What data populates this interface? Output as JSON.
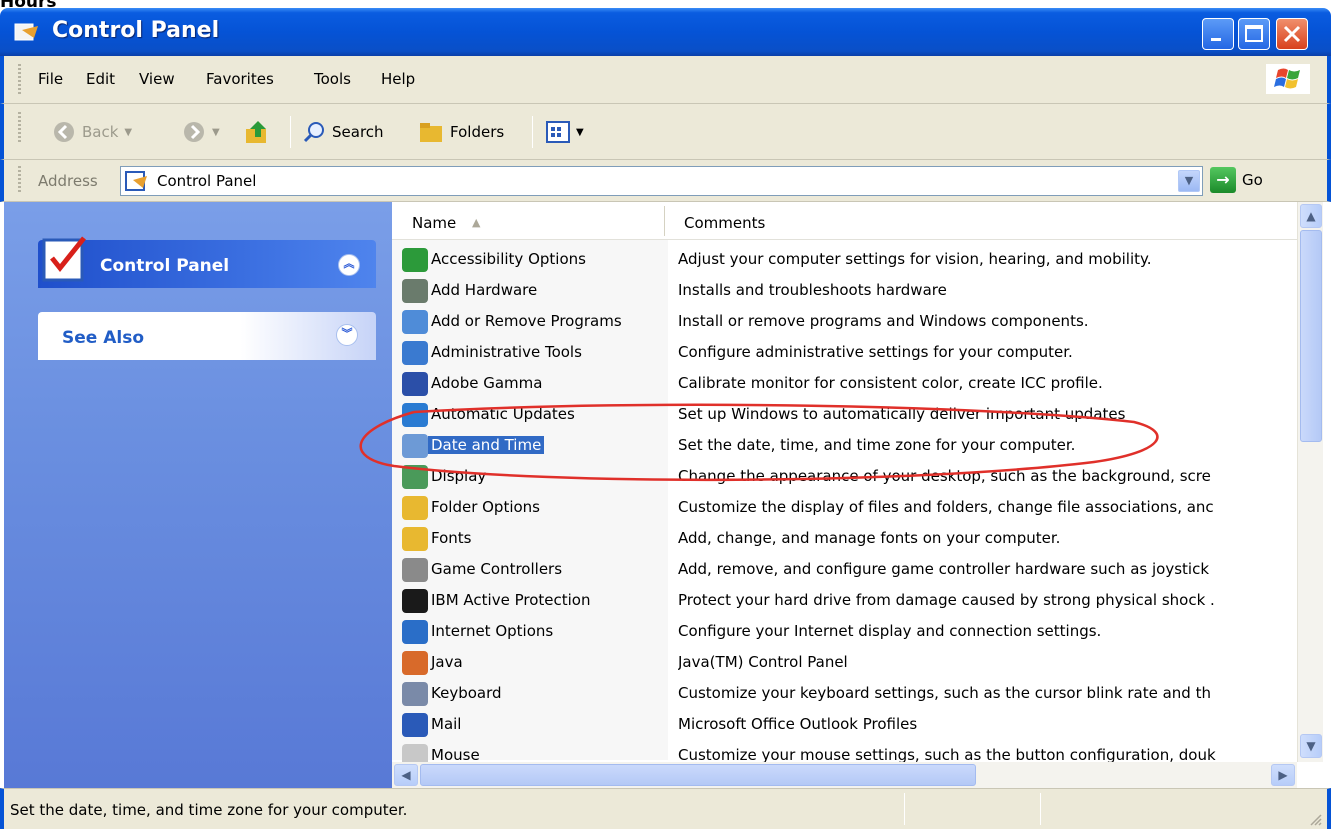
{
  "top_label": "Hours",
  "window": {
    "title": "Control Panel"
  },
  "menu": [
    "File",
    "Edit",
    "View",
    "Favorites",
    "Tools",
    "Help"
  ],
  "toolbar": {
    "back": "Back",
    "search": "Search",
    "folders": "Folders"
  },
  "address": {
    "label": "Address",
    "value": "Control Panel",
    "go": "Go"
  },
  "task_pane": {
    "panel_title": "Control Panel",
    "see_also": "See Also"
  },
  "columns": {
    "name": "Name",
    "comments": "Comments"
  },
  "items": [
    {
      "name": "Accessibility Options",
      "comment": "Adjust your computer settings for vision, hearing, and mobility.",
      "icon": "accessibility-icon",
      "color": "#2c9a3a"
    },
    {
      "name": "Add Hardware",
      "comment": "Installs and troubleshoots hardware",
      "icon": "hardware-icon",
      "color": "#6a7b6c"
    },
    {
      "name": "Add or Remove Programs",
      "comment": "Install or remove programs and Windows components.",
      "icon": "programs-icon",
      "color": "#4f8cd8"
    },
    {
      "name": "Administrative Tools",
      "comment": "Configure administrative settings for your computer.",
      "icon": "admin-tools-icon",
      "color": "#3a7ad0"
    },
    {
      "name": "Adobe Gamma",
      "comment": "Calibrate monitor for consistent color, create ICC profile.",
      "icon": "monitor-icon",
      "color": "#2b4fa8"
    },
    {
      "name": "Automatic Updates",
      "comment": "Set up Windows to automatically deliver important updates",
      "icon": "globe-icon",
      "color": "#2a7bd2"
    },
    {
      "name": "Date and Time",
      "comment": "Set the date, time, and time zone for your computer.",
      "icon": "clock-icon",
      "color": "#6d9ad6"
    },
    {
      "name": "Display",
      "comment": "Change the appearance of your desktop, such as the background, scre",
      "icon": "display-icon",
      "color": "#4a9a5a"
    },
    {
      "name": "Folder Options",
      "comment": "Customize the display of files and folders, change file associations, anc",
      "icon": "folder-icon",
      "color": "#e8b830"
    },
    {
      "name": "Fonts",
      "comment": "Add, change, and manage fonts on your computer.",
      "icon": "fonts-folder-icon",
      "color": "#e8b830"
    },
    {
      "name": "Game Controllers",
      "comment": "Add, remove, and configure game controller hardware such as joystick",
      "icon": "joystick-icon",
      "color": "#8a8a8a"
    },
    {
      "name": "IBM Active Protection",
      "comment": "Protect your hard drive from damage caused by strong physical shock .",
      "icon": "shield-icon",
      "color": "#1a1a1a"
    },
    {
      "name": "Internet Options",
      "comment": "Configure your Internet display and connection settings.",
      "icon": "internet-icon",
      "color": "#2a6ec8"
    },
    {
      "name": "Java",
      "comment": "Java(TM) Control Panel",
      "icon": "java-icon",
      "color": "#d86a2a"
    },
    {
      "name": "Keyboard",
      "comment": "Customize your keyboard settings, such as the cursor blink rate and th",
      "icon": "keyboard-icon",
      "color": "#7a8aa8"
    },
    {
      "name": "Mail",
      "comment": "Microsoft Office Outlook Profiles",
      "icon": "mail-icon",
      "color": "#2a5ab8"
    },
    {
      "name": "Mouse",
      "comment": "Customize your mouse settings, such as the button configuration, douk",
      "icon": "mouse-icon",
      "color": "#c8c8c8"
    }
  ],
  "selected_index": 6,
  "status": "Set the date, time, and time zone for your computer.",
  "colors": {
    "title_bar": "#0553d6",
    "selection": "#316ac5",
    "annotation": "#e0302a",
    "task_pane": "#6a8fe0"
  }
}
